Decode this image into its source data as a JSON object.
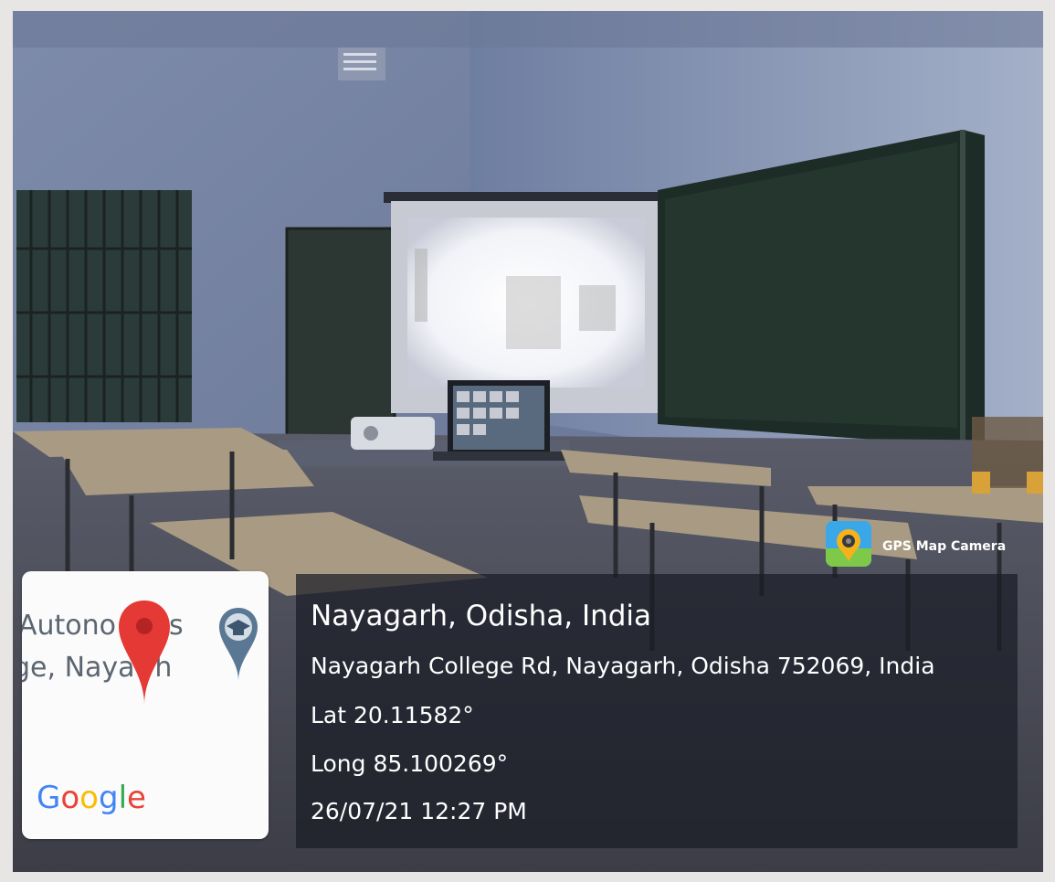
{
  "watermark": {
    "app_name": "GPS Map Camera",
    "icon": "location-camera-icon"
  },
  "map": {
    "line1": "Autono",
    "line1_tail": "s",
    "line2": "ge, Naya",
    "line2_tail": "rh",
    "pin_icon": "map-pin-icon",
    "pin_color": "#e53935",
    "college_icon": "graduation-cap-pin-icon",
    "logo": "Google"
  },
  "location": {
    "place": "Nayagarh, Odisha, India",
    "address": "Nayagarh College Rd, Nayagarh, Odisha 752069, India",
    "latitude": "Lat 20.11582°",
    "longitude": "Long 85.100269°",
    "timestamp": "26/07/21 12:27 PM"
  }
}
